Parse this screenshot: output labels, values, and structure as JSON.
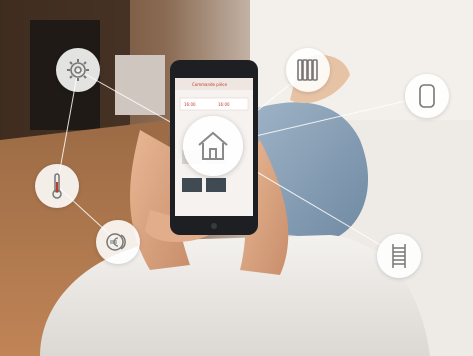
{
  "scene": {
    "description_icons": [
      "home-icon",
      "gear-icon",
      "radiator-icon",
      "boiler-icon",
      "thermometer-icon",
      "money-icon",
      "towel-rail-icon"
    ]
  },
  "phone_screen": {
    "title": "Commande pièce",
    "tab_left": "16:00",
    "tab_right": "16:00"
  },
  "colors": {
    "accent": "#c0392b",
    "bubble": "#ffffff",
    "line": "#ffffff"
  }
}
